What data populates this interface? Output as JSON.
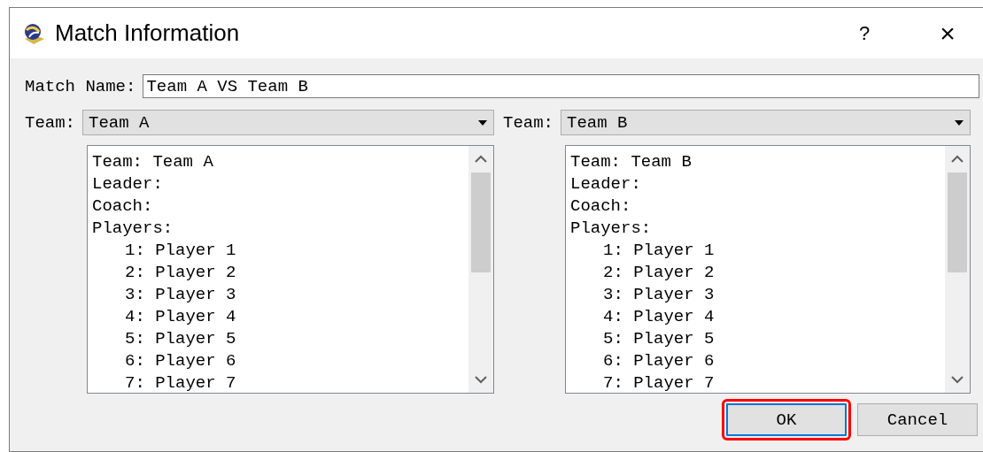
{
  "window": {
    "title": "Match Information",
    "help": "?",
    "close": "×"
  },
  "match_name": {
    "label": "Match Name:",
    "value": "Team A VS Team B"
  },
  "teams": [
    {
      "label": "Team:",
      "selected_team": "Team A",
      "details": [
        "Team: Team A",
        "Leader:",
        "Coach:",
        "Players:"
      ],
      "players": [
        "1: Player 1",
        "2: Player 2",
        "3: Player 3",
        "4: Player 4",
        "5: Player 5",
        "6: Player 6",
        "7: Player 7"
      ]
    },
    {
      "label": "Team:",
      "selected_team": "Team B",
      "details": [
        "Team: Team B",
        "Leader:",
        "Coach:",
        "Players:"
      ],
      "players": [
        "1: Player 1",
        "2: Player 2",
        "3: Player 3",
        "4: Player 4",
        "5: Player 5",
        "6: Player 6",
        "7: Player 7"
      ]
    }
  ],
  "buttons": [
    {
      "label": "OK",
      "focused": true,
      "highlighted": true
    },
    {
      "label": "Cancel",
      "focused": false,
      "highlighted": false
    }
  ]
}
